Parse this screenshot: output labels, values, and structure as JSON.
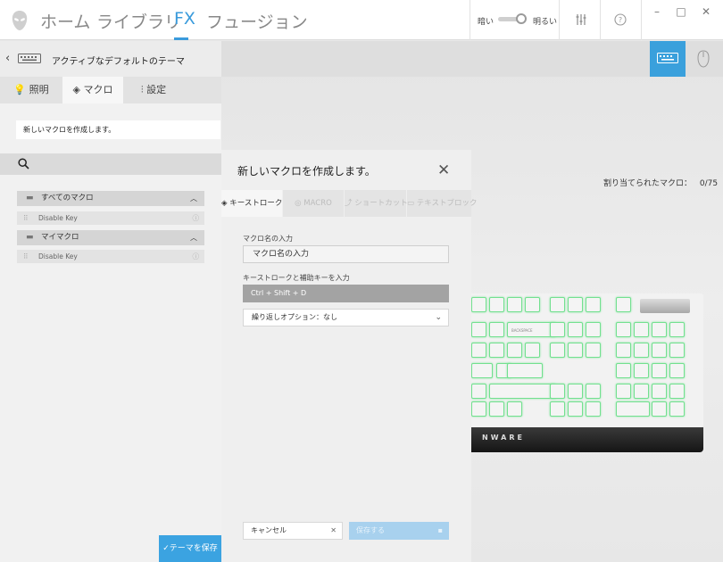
{
  "nav": {
    "items": [
      {
        "label": "ホーム"
      },
      {
        "label": "ライブラリ"
      },
      {
        "label": "FX"
      },
      {
        "label": "フュージョン"
      }
    ],
    "brightness_dark": "暗い",
    "brightness_bright": "明るい",
    "window": {
      "minimize": "–",
      "maximize": "□",
      "close": "✕"
    }
  },
  "left_panel": {
    "back_title": "アクティブなデフォルトのテーマ",
    "tabs": [
      {
        "label": "照明"
      },
      {
        "label": "マクロ"
      },
      {
        "label": "設定"
      }
    ],
    "note": "新しいマクロを作成します。",
    "groups": [
      {
        "label": "すべてのマクロ",
        "items": [
          {
            "label": "Disable Key"
          }
        ]
      },
      {
        "label": "マイマクロ",
        "items": [
          {
            "label": "Disable Key"
          }
        ]
      }
    ],
    "save_theme": "✓テーマを保存"
  },
  "stage": {
    "assigned_label": "割り当てられたマクロ：",
    "assigned_count": "0/75",
    "keyboard_brand": "NWARE",
    "key_legend": "BACKSPACE"
  },
  "modal": {
    "title": "新しいマクロを作成します。",
    "tabs": [
      {
        "label": "キーストローク",
        "enabled": true
      },
      {
        "label": "MACRO",
        "enabled": false
      },
      {
        "label": "ショートカット",
        "enabled": false
      },
      {
        "label": "テキストブロック",
        "enabled": false
      }
    ],
    "name_label": "マクロ名の入力",
    "name_value": "マクロ名の入力",
    "keystroke_label": "キーストロークと補助キーを入力",
    "keystroke_value": "Ctrl + Shift + D",
    "repeat_option": "繰り返しオプション：なし",
    "cancel_label": "キャンセル",
    "save_label": "保存する"
  },
  "colors": {
    "accent": "#3a9bdc",
    "save_theme_bg": "#3ba3e1",
    "key_glow": "#72e08f"
  }
}
